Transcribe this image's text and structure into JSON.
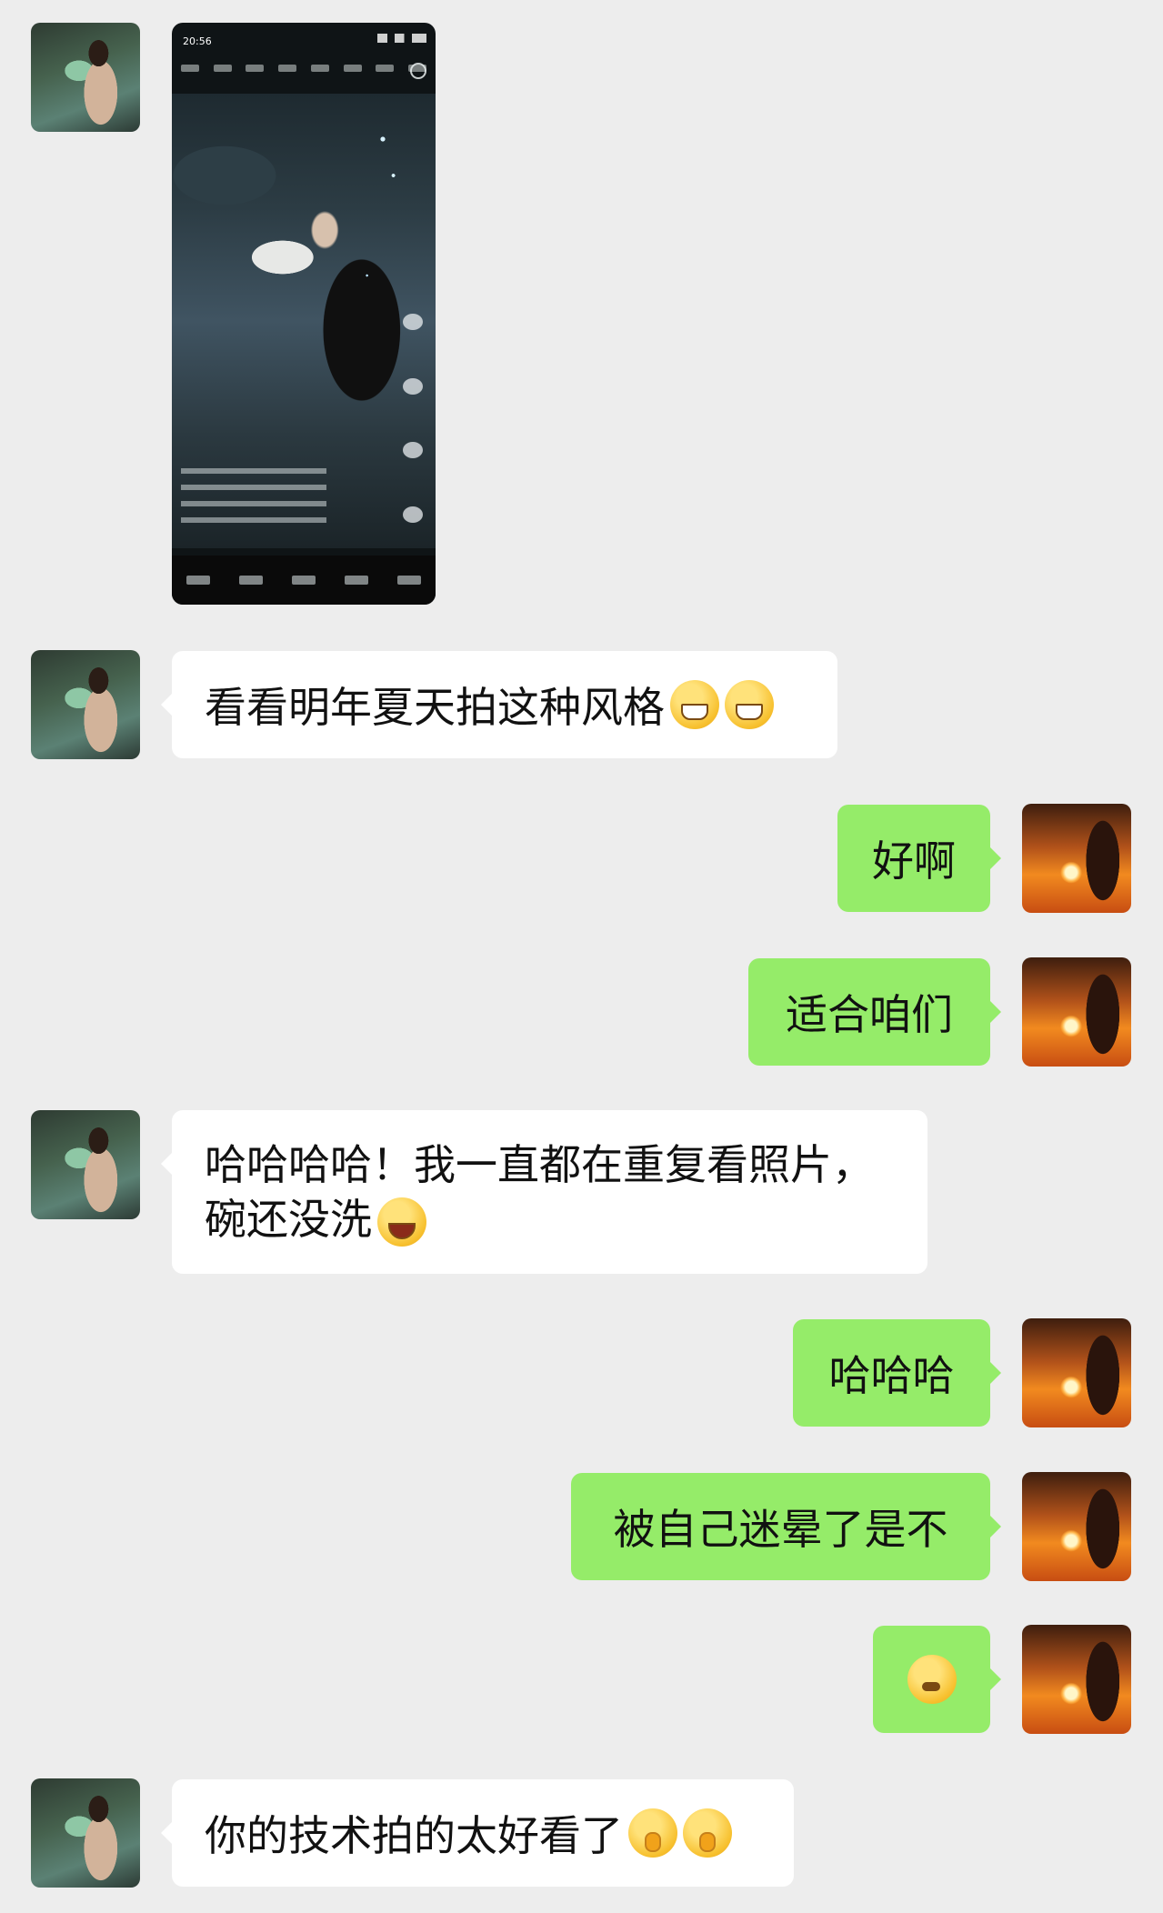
{
  "phone_screenshot": {
    "status_time": "20:56"
  },
  "messages": [
    {
      "side": "left",
      "text": "看看明年夏天拍这种风格",
      "emojis": [
        "grin",
        "grin"
      ]
    },
    {
      "side": "right",
      "text": "好啊"
    },
    {
      "side": "right",
      "text": "适合咱们"
    },
    {
      "side": "left",
      "line1": "哈哈哈哈！我一直都在重复看照片，",
      "line2": "碗还没洗",
      "emojis": [
        "laugh"
      ]
    },
    {
      "side": "right",
      "text": "哈哈哈"
    },
    {
      "side": "right",
      "text": "被自己迷晕了是不"
    },
    {
      "side": "right",
      "emojis": [
        "thinking"
      ]
    },
    {
      "side": "left",
      "text": "你的技术拍的太好看了",
      "emojis": [
        "cover",
        "cover"
      ]
    }
  ]
}
